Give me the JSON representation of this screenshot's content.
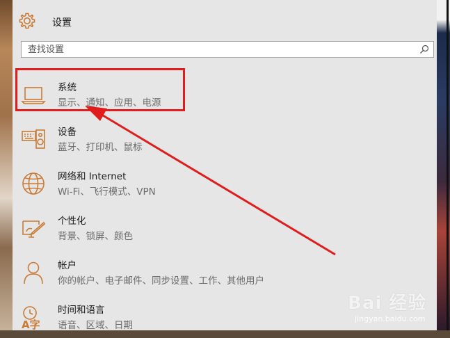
{
  "header": {
    "title": "设置",
    "icon": "gear-icon"
  },
  "search": {
    "placeholder": "查找设置",
    "icon": "search-icon"
  },
  "items": [
    {
      "label": "系统",
      "desc": "显示、通知、应用、电源",
      "icon": "laptop-icon"
    },
    {
      "label": "设备",
      "desc": "蓝牙、打印机、鼠标",
      "icon": "devices-icon"
    },
    {
      "label": "网络和 Internet",
      "desc": "Wi-Fi、飞行模式、VPN",
      "icon": "globe-icon"
    },
    {
      "label": "个性化",
      "desc": "背景、锁屏、颜色",
      "icon": "personalize-icon"
    },
    {
      "label": "帐户",
      "desc": "你的帐户、电子邮件、同步设置、工作、其他用户",
      "icon": "person-icon"
    },
    {
      "label": "时间和语言",
      "desc": "语音、区域、日期",
      "icon": "time-language-icon"
    }
  ],
  "colors": {
    "accent": "#c97a36",
    "annotation": "#e01c1c",
    "window_bg": "#e6e6e6"
  },
  "watermark": {
    "brand": "Bai 经验",
    "site": "jingyan.baidu.com"
  }
}
